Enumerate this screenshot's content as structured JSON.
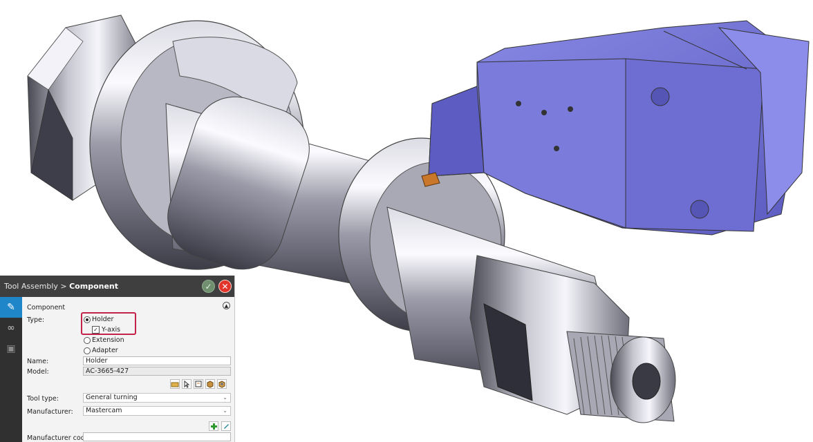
{
  "breadcrumb": {
    "parent": "Tool Assembly >",
    "current": "Component"
  },
  "header_buttons": {
    "ok_icon": "checkmark-icon",
    "close_icon": "close-icon"
  },
  "sidebar": {
    "icons": [
      "tool-icon",
      "link-icon",
      "layout-icon"
    ]
  },
  "section": {
    "title": "Component",
    "collapse_icon": "chevron-up-icon"
  },
  "type": {
    "label": "Type:",
    "options": [
      "Holder",
      "Y-axis",
      "Extension",
      "Adapter"
    ],
    "selected": "Holder",
    "y_axis_checked": true
  },
  "name": {
    "label": "Name:",
    "value": "Holder"
  },
  "model": {
    "label": "Model:",
    "value": "AC-3665-427"
  },
  "model_tools": [
    "open-folder-icon",
    "select-arrow-icon",
    "tool-list-icon",
    "box-icon",
    "gear-box-icon"
  ],
  "tool_type": {
    "label": "Tool type:",
    "value": "General turning"
  },
  "manufacturer": {
    "label": "Manufacturer:",
    "value": "Mastercam"
  },
  "manufacturer_tools": [
    "add-icon",
    "edit-icon"
  ],
  "manufacturer_code": {
    "label": "Manufacturer code:",
    "value": ""
  },
  "colors": {
    "accent": "#1f86c9",
    "highlight": "#c3204a",
    "holder": "#7777d8",
    "insert": "#c9772a"
  }
}
